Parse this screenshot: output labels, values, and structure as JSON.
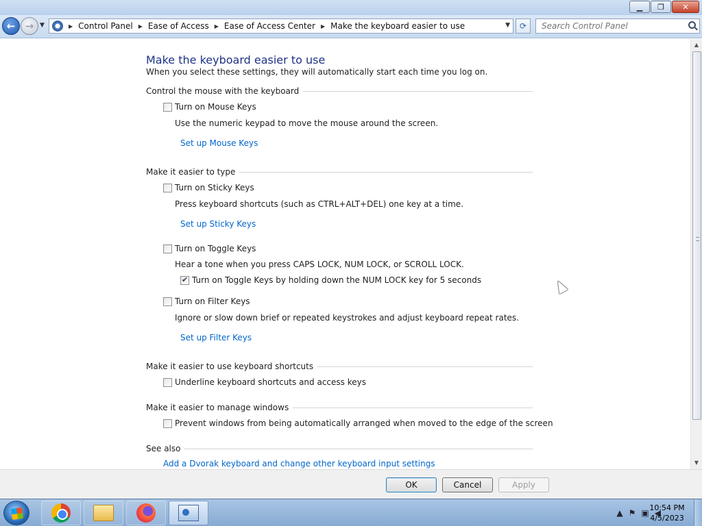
{
  "window": {
    "caption_buttons": {
      "minimize": "▁",
      "maximize": "❐",
      "close": "✕"
    }
  },
  "nav": {
    "back_glyph": "←",
    "forward_glyph": "→",
    "dropdown_glyph": "▼",
    "refresh_glyph": "⟳",
    "breadcrumb": [
      "Control Panel",
      "Ease of Access",
      "Ease of Access Center",
      "Make the keyboard easier to use"
    ],
    "breadcrumb_sep": "▶",
    "search_placeholder": "Search Control Panel"
  },
  "page": {
    "title": "Make the keyboard easier to use",
    "subtitle": "When you select these settings, they will automatically start each time you log on.",
    "groups": {
      "mouse": "Control the mouse with the keyboard",
      "type": "Make it easier to type",
      "shortcuts": "Make it easier to use keyboard shortcuts",
      "windows": "Make it easier to manage windows",
      "see_also": "See also"
    },
    "mouse_keys": {
      "label": "Turn on Mouse Keys",
      "checked": false,
      "desc": "Use the numeric keypad to move the mouse around the screen.",
      "link": "Set up Mouse Keys"
    },
    "sticky_keys": {
      "label": "Turn on Sticky Keys",
      "checked": false,
      "desc": "Press keyboard shortcuts (such as CTRL+ALT+DEL) one key at a time.",
      "link": "Set up Sticky Keys"
    },
    "toggle_keys": {
      "label": "Turn on Toggle Keys",
      "checked": false,
      "desc": "Hear a tone when you press CAPS LOCK, NUM LOCK, or SCROLL LOCK.",
      "sub_label": "Turn on Toggle Keys by holding down the NUM LOCK key for 5 seconds",
      "sub_checked": true
    },
    "filter_keys": {
      "label": "Turn on Filter Keys",
      "checked": false,
      "desc": "Ignore or slow down brief or repeated keystrokes and adjust keyboard repeat rates.",
      "link": "Set up Filter Keys"
    },
    "underline": {
      "label": "Underline keyboard shortcuts and access keys",
      "checked": false
    },
    "prevent_arrange": {
      "label": "Prevent windows from being automatically arranged when moved to the edge of the screen",
      "checked": false
    },
    "see_also_link": "Add a Dvorak keyboard and change other keyboard input settings"
  },
  "footer": {
    "ok": "OK",
    "cancel": "Cancel",
    "apply": "Apply"
  },
  "taskbar": {
    "apps": [
      "chrome-icon",
      "file-explorer-icon",
      "firefox-icon",
      "control-panel-icon"
    ],
    "tray_arrow": "▲",
    "time": "10:54 PM",
    "date": "4/5/2023"
  },
  "colors": {
    "link": "#0066cc",
    "heading": "#1e3287"
  }
}
